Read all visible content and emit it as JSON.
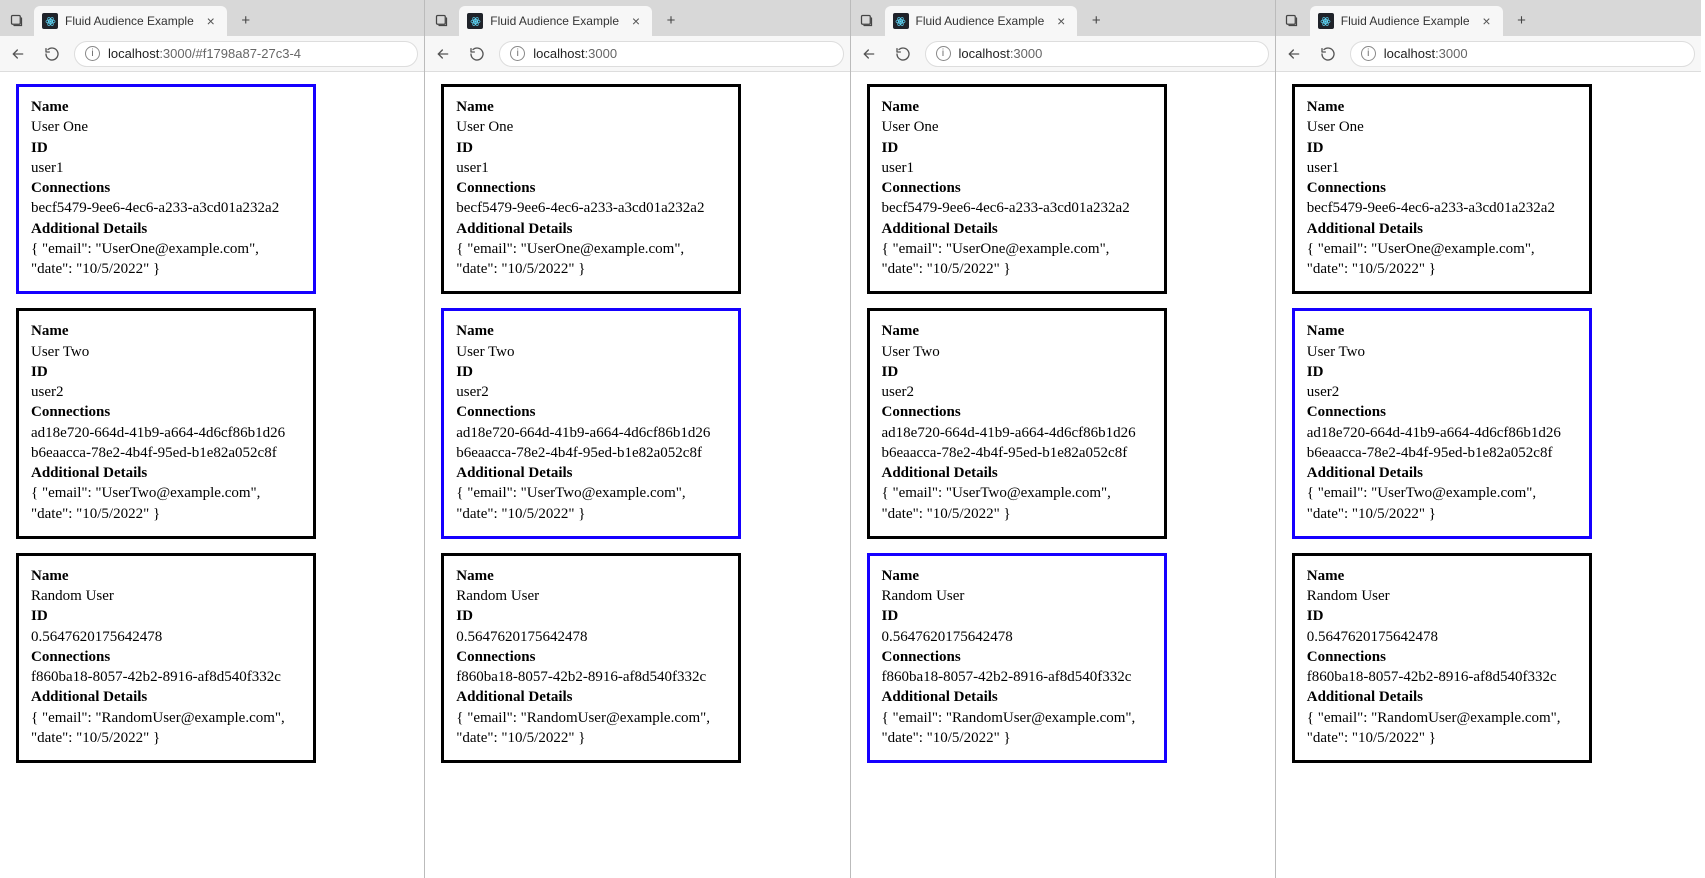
{
  "tab_title": "Fluid Audience Example",
  "url_display_host": "localhost",
  "url_display_port": ":3000",
  "url_display_path_long": "/#f1798a87-27c3-4",
  "labels": {
    "name": "Name",
    "id": "ID",
    "connections": "Connections",
    "additional_details": "Additional Details"
  },
  "users": [
    {
      "name": "User One",
      "id": "user1",
      "connections": [
        "becf5479-9ee6-4ec6-a233-a3cd01a232a2"
      ],
      "details": "{ \"email\": \"UserOne@example.com\", \"date\": \"10/5/2022\" }"
    },
    {
      "name": "User Two",
      "id": "user2",
      "connections": [
        "ad18e720-664d-41b9-a664-4d6cf86b1d26",
        "b6eaacca-78e2-4b4f-95ed-b1e82a052c8f"
      ],
      "details": "{ \"email\": \"UserTwo@example.com\", \"date\": \"10/5/2022\" }"
    },
    {
      "name": "Random User",
      "id": "0.5647620175642478",
      "connections": [
        "f860ba18-8057-42b2-8916-af8d540f332c"
      ],
      "details": "{ \"email\": \"RandomUser@example.com\", \"date\": \"10/5/2022\" }"
    }
  ],
  "windows": [
    {
      "selected_index": 0,
      "show_long_url": true
    },
    {
      "selected_index": 1,
      "show_long_url": false
    },
    {
      "selected_index": 2,
      "show_long_url": false
    },
    {
      "selected_index": 1,
      "show_long_url": false
    }
  ]
}
